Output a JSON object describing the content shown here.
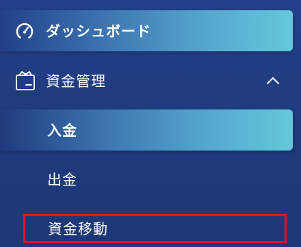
{
  "sidebar": {
    "dashboard": {
      "label": "ダッシュボード",
      "icon": "gauge-icon",
      "active": true
    },
    "funds": {
      "label": "資金管理",
      "icon": "wallet-icon",
      "expanded": true,
      "toggle_icon": "chevron-up-icon",
      "children": [
        {
          "label": "入金",
          "active": true
        },
        {
          "label": "出金",
          "active": false
        },
        {
          "label": "資金移動",
          "active": false,
          "highlighted": true
        }
      ]
    }
  },
  "colors": {
    "background": "#1f3b7e",
    "active_gradient_end": "#63c9da",
    "highlight_border": "#e3141f",
    "text": "#ffffff"
  }
}
